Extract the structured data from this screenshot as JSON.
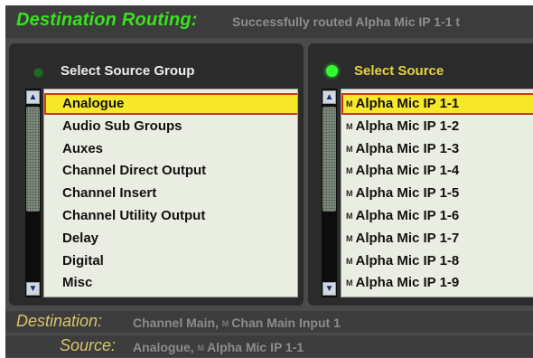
{
  "header": {
    "label": "Destination Routing:",
    "message": "Successfully routed Alpha Mic IP 1-1 t"
  },
  "source_group_panel": {
    "title": "Select Source Group",
    "items": [
      {
        "label": "Analogue",
        "selected": true
      },
      {
        "label": "Audio Sub Groups"
      },
      {
        "label": "Auxes"
      },
      {
        "label": "Channel Direct Output"
      },
      {
        "label": "Channel Insert"
      },
      {
        "label": "Channel Utility Output"
      },
      {
        "label": "Delay"
      },
      {
        "label": "Digital"
      },
      {
        "label": "Misc"
      }
    ]
  },
  "source_panel": {
    "title": "Select Source",
    "items": [
      {
        "badge": "M",
        "label": "Alpha Mic IP 1-1",
        "selected": true
      },
      {
        "badge": "M",
        "label": "Alpha Mic IP 1-2"
      },
      {
        "badge": "M",
        "label": "Alpha Mic IP 1-3"
      },
      {
        "badge": "M",
        "label": "Alpha Mic IP 1-4"
      },
      {
        "badge": "M",
        "label": "Alpha Mic IP 1-5"
      },
      {
        "badge": "M",
        "label": "Alpha Mic IP 1-6"
      },
      {
        "badge": "M",
        "label": "Alpha Mic IP 1-7"
      },
      {
        "badge": "M",
        "label": "Alpha Mic IP 1-8"
      },
      {
        "badge": "M",
        "label": "Alpha Mic IP 1-9"
      }
    ]
  },
  "status": {
    "destination_label": "Destination:",
    "destination_value_prefix": "Channel Main,",
    "destination_badge": "M",
    "destination_value_suffix": "Chan Main Input 1",
    "source_label": "Source:",
    "source_value_prefix": "Analogue,",
    "source_badge": "M",
    "source_value_suffix": "Alpha Mic IP 1-1"
  },
  "icons": {
    "scroll_up": "triangle-up-icon",
    "scroll_down": "triangle-down-icon",
    "led": "status-led-icon"
  },
  "colors": {
    "header_label": "#39e21c",
    "selected_bg": "#f7e92a",
    "selected_border": "#c83a1c",
    "led_on": "#2fff2f",
    "source_title": "#e7d33a",
    "status_label": "#d9c46a"
  }
}
